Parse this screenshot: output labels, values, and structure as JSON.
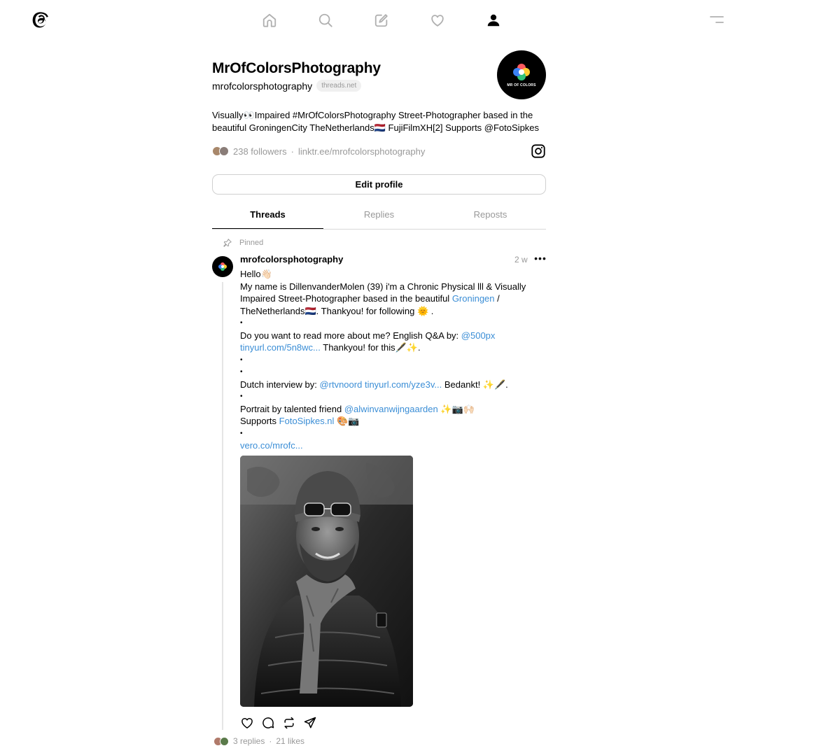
{
  "profile": {
    "display_name": "MrOfColorsPhotography",
    "handle": "mrofcolorsphotography",
    "domain": "threads.net",
    "avatar_text": "MR OF COLORS",
    "bio": "Visually👀Impaired #MrOfColorsPhotography Street-Photographer based in the beautiful GroningenCity TheNetherlands🇳🇱 FujiFilmXH[2] Supports @FotoSipkes",
    "followers": "238 followers",
    "link": "linktr.ee/mrofcolorsphotography",
    "edit_label": "Edit profile"
  },
  "nav": {
    "items": [
      "home-icon",
      "search-icon",
      "compose-icon",
      "heart-icon",
      "profile-icon"
    ]
  },
  "tabs": [
    {
      "label": "Threads",
      "active": true
    },
    {
      "label": "Replies",
      "active": false
    },
    {
      "label": "Reposts",
      "active": false
    }
  ],
  "post": {
    "pinned_label": "Pinned",
    "username": "mrofcolorsphotography",
    "time": "2 w",
    "more": "•••",
    "lines": {
      "l1": "Hello👋🏻",
      "l2": "My name is DillenvanderMolen (39) i'm a Chronic Physical lll & Visually Impaired Street-Photographer based in the beautiful ",
      "l2_link": "Groningen",
      "l2_tail": " / TheNetherlands🇳🇱. Thankyou! for following 🌞 .",
      "l3": "Do you want to read more about me? English Q&A by: ",
      "l3_link1": "@500px",
      "l3_link2": "tinyurl.com/5n8wc...",
      "l3_tail": " Thankyou! for this🖋️✨.",
      "l4": "Dutch interview by: ",
      "l4_link1": "@rtvnoord",
      "l4_link2": "tinyurl.com/yze3v...",
      "l4_tail": " Bedankt! ✨🖋️.",
      "l5": "Portrait by talented friend ",
      "l5_link": "@alwinvanwijngaarden",
      "l5_tail": " ✨📷🙌🏻",
      "l6": "Supports ",
      "l6_link": "FotoSipkes.nl",
      "l6_tail": " 🎨📷",
      "l7_link": "vero.co/mrofc...",
      "dot": "•"
    },
    "replies": "3 replies",
    "likes": "21 likes"
  },
  "colors": {
    "link": "#3b8ed6",
    "muted": "#999999",
    "divider": "#d8d8d8"
  }
}
